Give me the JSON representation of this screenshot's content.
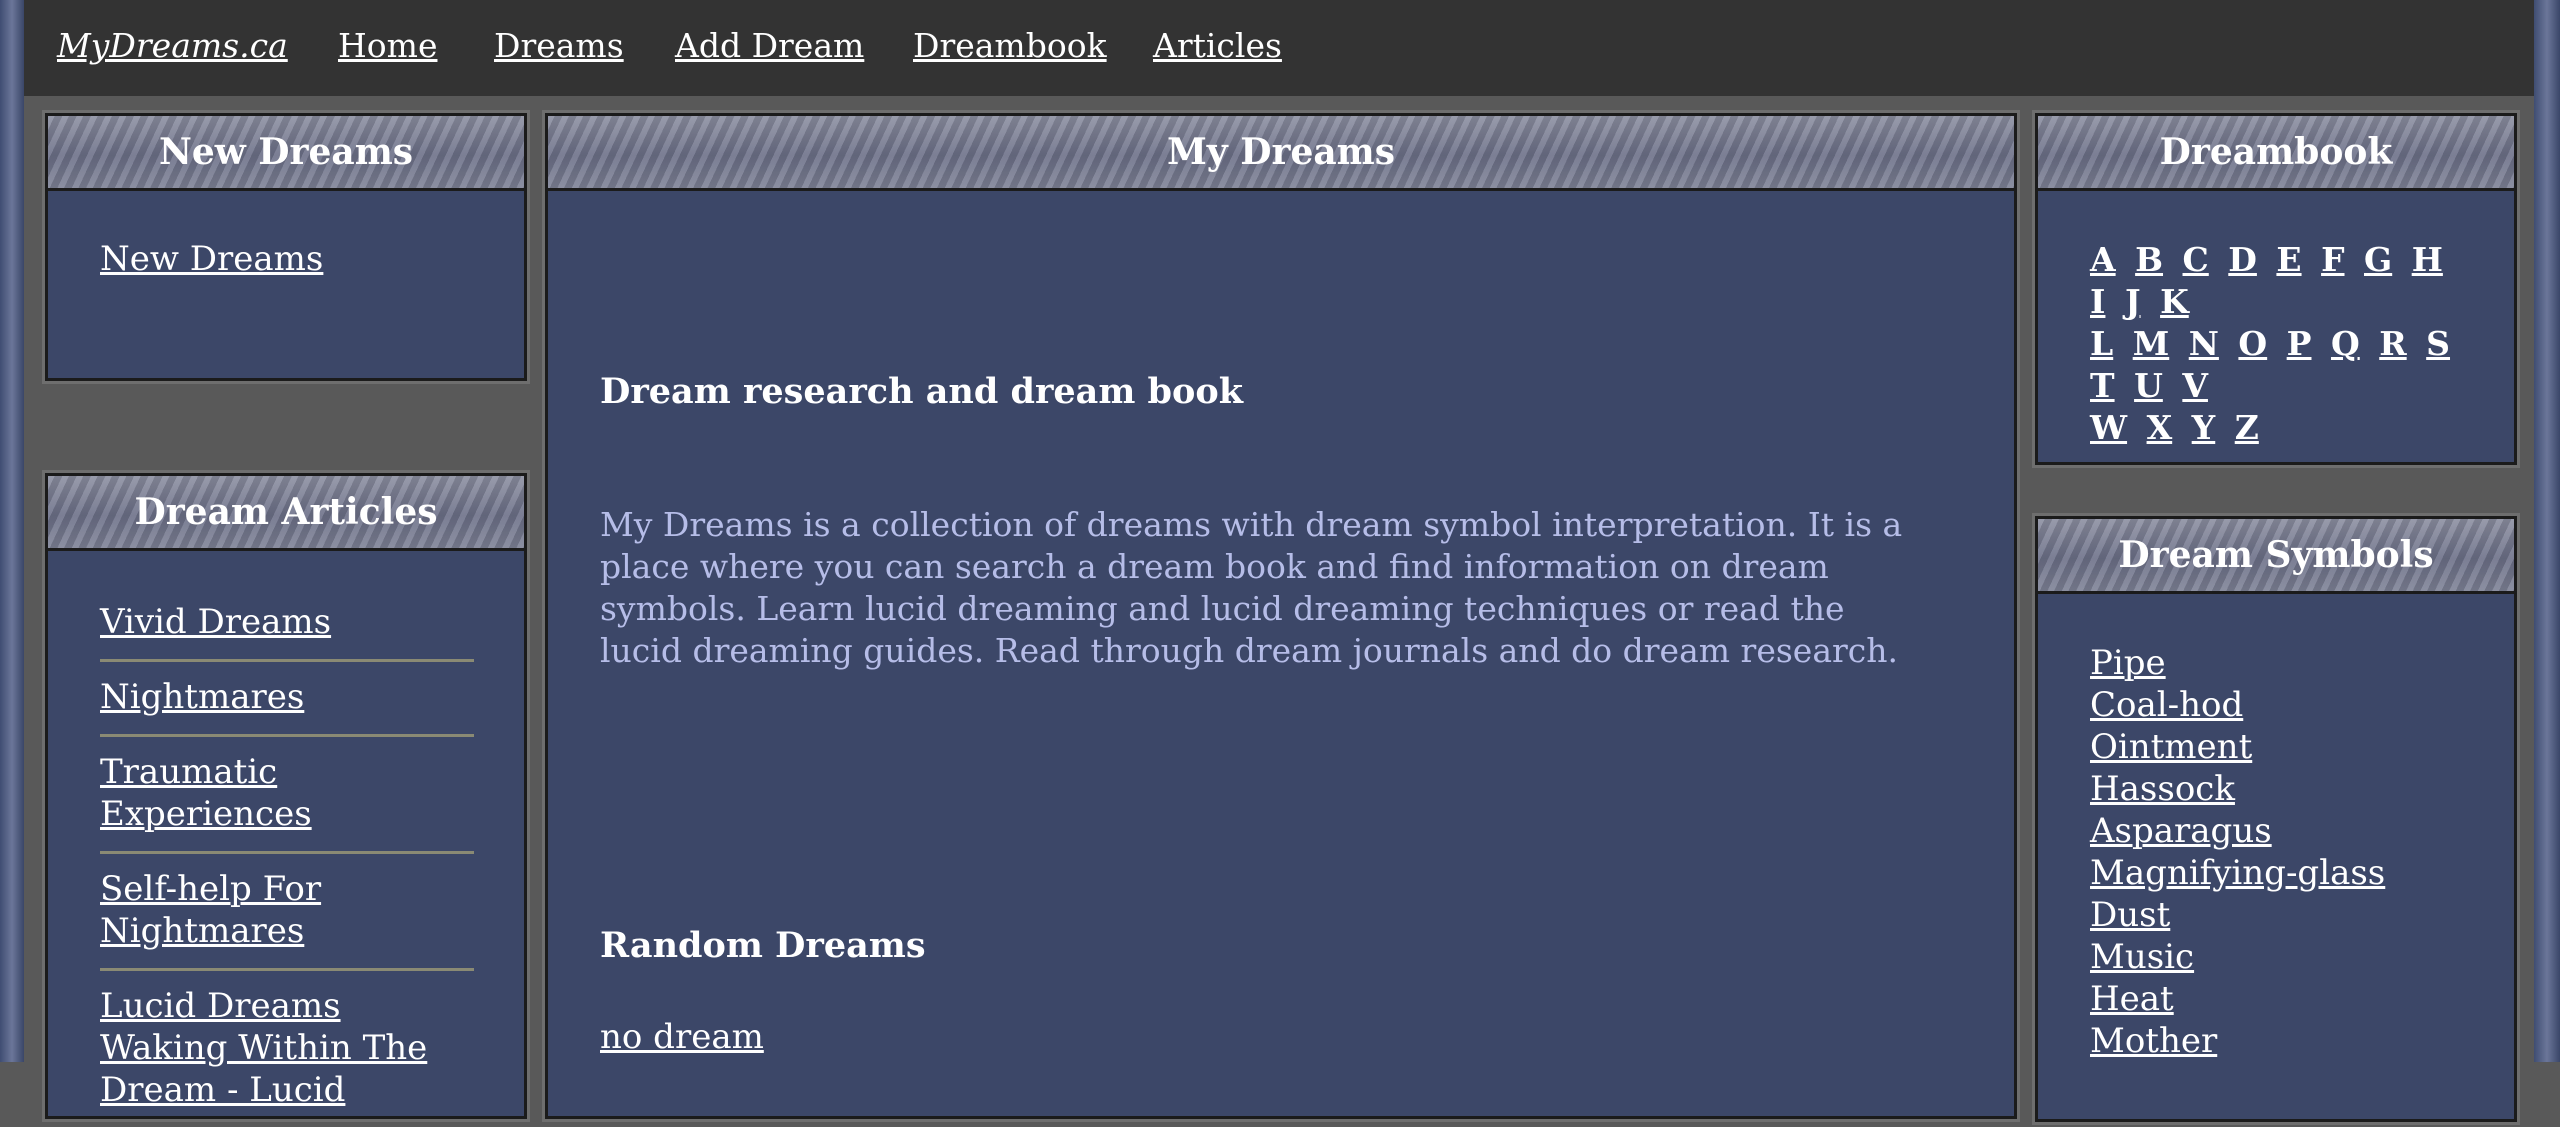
{
  "nav": {
    "brand": "MyDreams.ca",
    "items": [
      "Home",
      "Dreams",
      "Add Dream",
      "Dreambook",
      "Articles"
    ]
  },
  "new_dreams": {
    "title": "New Dreams",
    "link": "New Dreams"
  },
  "dream_articles": {
    "title": "Dream Articles",
    "items": [
      "Vivid Dreams",
      "Nightmares",
      "Traumatic Experiences",
      "Self-help For Nightmares",
      "Lucid Dreams Waking Within The Dream - Lucid"
    ]
  },
  "main": {
    "title": "My Dreams",
    "heading": "Dream research and dream book",
    "intro": "My Dreams is a collection of dreams with dream symbol interpretation. It is a place where you can search a dream book and find information on dream symbols. Learn lucid dreaming and lucid dreaming techniques or read the lucid dreaming guides. Read through dream journals and do dream research.",
    "random_heading": "Random Dreams",
    "random_link": "no dream"
  },
  "dreambook": {
    "title": "Dreambook",
    "letters": [
      "A",
      "B",
      "C",
      "D",
      "E",
      "F",
      "G",
      "H",
      "I",
      "J",
      "K",
      "L",
      "M",
      "N",
      "O",
      "P",
      "Q",
      "R",
      "S",
      "T",
      "U",
      "V",
      "W",
      "X",
      "Y",
      "Z"
    ]
  },
  "dream_symbols": {
    "title": "Dream Symbols",
    "items": [
      "Pipe",
      "Coal-hod",
      "Ointment",
      "Hassock",
      "Asparagus",
      "Magnifying-glass",
      "Dust",
      "Music",
      "Heat",
      "Mother"
    ]
  }
}
